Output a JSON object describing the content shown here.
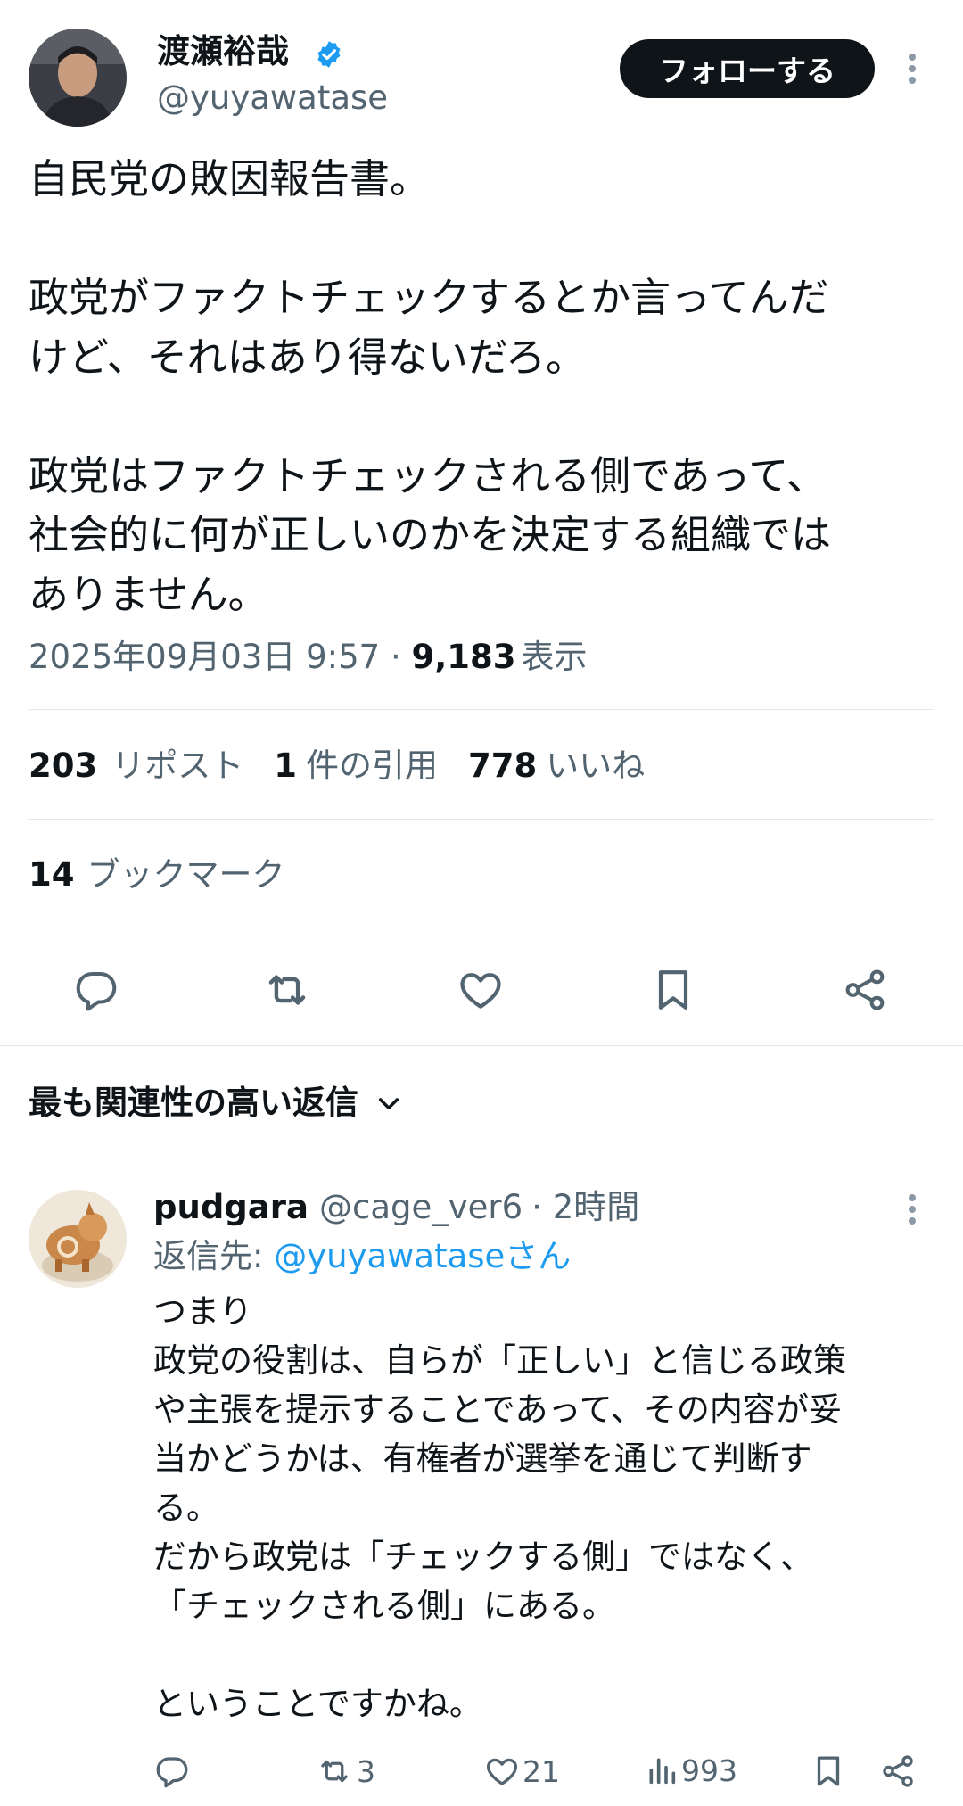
{
  "tweet": {
    "author_name": "渡瀬裕哉",
    "author_handle": "@yuyawatase",
    "follow_label": "フォローする",
    "text_lines": [
      "自民党の敗因報告書。",
      "",
      "政党がファクトチェックするとか言ってんだ",
      "けど、それはあり得ないだろ。",
      "",
      "政党はファクトチェックされる側であって、",
      "社会的に何が正しいのかを決定する組織では",
      "ありません。"
    ],
    "timestamp": "2025年09月03日 9:57",
    "views_count": "9,183",
    "views_label": "表示"
  },
  "stats": {
    "reposts_count": "203",
    "reposts_label": "リポスト",
    "quotes_count": "1",
    "quotes_label": "件の引用",
    "likes_count": "778",
    "likes_label": "いいね",
    "bookmarks_count": "14",
    "bookmarks_label": "ブックマーク"
  },
  "icons": [
    "reply-icon",
    "retweet-icon",
    "like-icon",
    "bookmark-icon",
    "share-icon",
    "more-icon",
    "verified-badge-icon",
    "chevron-down-icon",
    "views-icon"
  ],
  "colors": {
    "accent": "#1d9bf0",
    "text": "#0f1419",
    "muted": "#536471",
    "follow_bg": "#0f1419"
  },
  "replies_sort_label": "最も関連性の高い返信",
  "reply": {
    "author_name": "pudgara",
    "author_handle": "@cage_ver6",
    "time": "· 2時間",
    "reply_to_prefix": "返信先: ",
    "reply_to_handle": "@yuyawataseさん",
    "text_lines": [
      "つまり",
      "政党の役割は、自らが「正しい」と信じる政策",
      "や主張を提示することであって、その内容が妥",
      "当かどうかは、有権者が選挙を通じて判断す",
      "る。",
      "だから政党は「チェックする側」ではなく、",
      "「チェックされる側」にある。",
      "",
      "ということですかね。"
    ],
    "retweets": "3",
    "likes": "21",
    "views": "993"
  }
}
